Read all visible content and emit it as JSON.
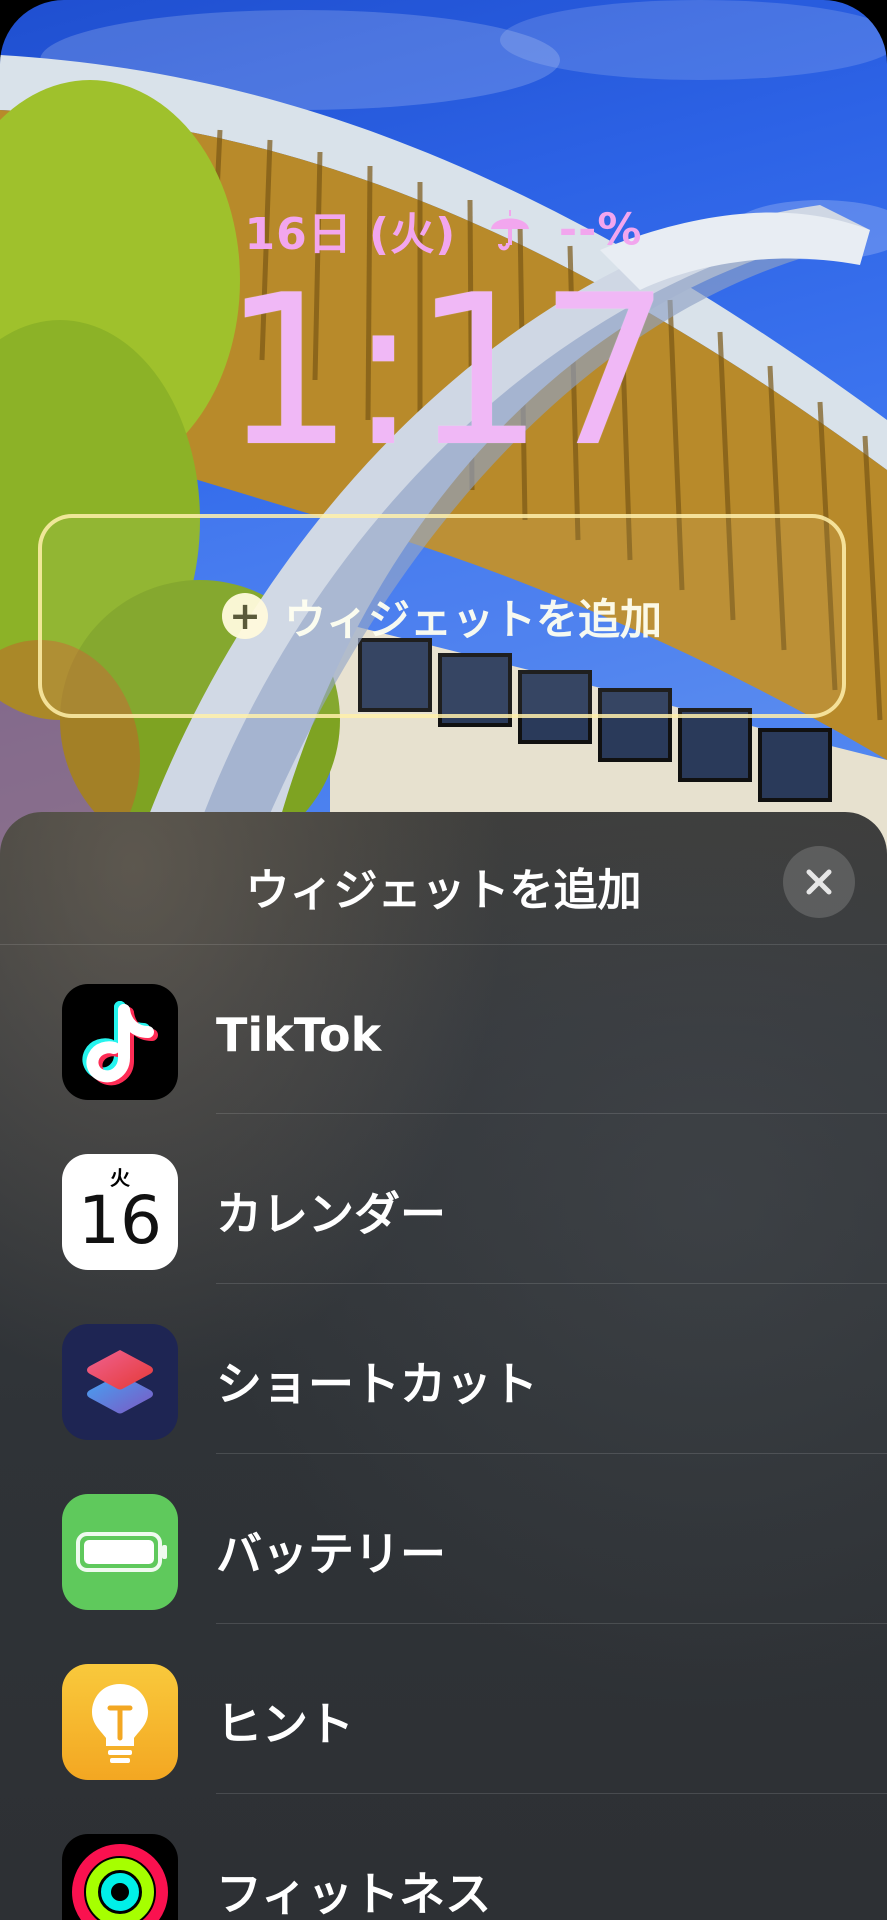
{
  "lock_screen": {
    "date": "16日 (火)",
    "battery": "--%",
    "time": "1:17",
    "widget_slot_label": "ウィジェットを追加"
  },
  "sheet": {
    "title": "ウィジェットを追加",
    "close_icon": "close-icon"
  },
  "apps": [
    {
      "name": "TikTok",
      "icon": "tiktok-icon"
    },
    {
      "name": "カレンダー",
      "icon": "calendar-icon",
      "icon_day": "火",
      "icon_date": "16"
    },
    {
      "name": "ショートカット",
      "icon": "shortcuts-icon"
    },
    {
      "name": "バッテリー",
      "icon": "battery-icon"
    },
    {
      "name": "ヒント",
      "icon": "tips-icon"
    },
    {
      "name": "フィットネス",
      "icon": "fitness-icon"
    }
  ],
  "colors": {
    "lock_text": "#f0b8f6",
    "sheet_bg": "#2f3337",
    "battery_green": "#5fc95c",
    "hint_yellow": "#f9c93c"
  }
}
